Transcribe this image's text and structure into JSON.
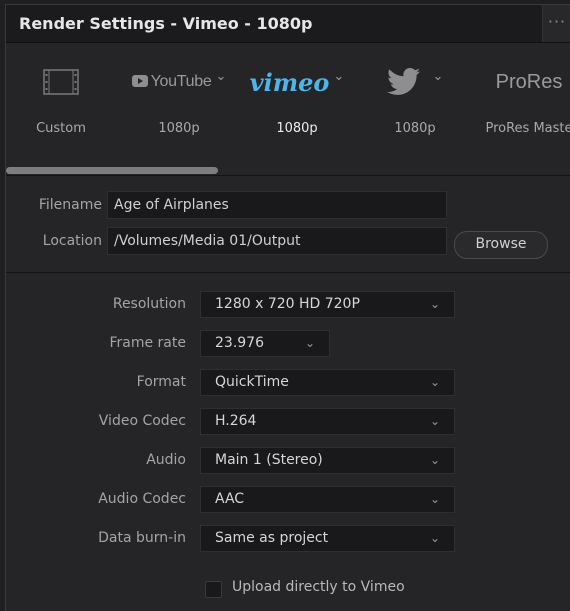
{
  "window": {
    "title": "Render Settings - Vimeo - 1080p",
    "more_icon": "ellipsis-icon",
    "more_glyph": "···"
  },
  "presets": [
    {
      "name": "Custom",
      "label": "Custom",
      "icon": "film-strip-icon"
    },
    {
      "name": "YouTube",
      "logo_text": "YouTube",
      "label": "1080p",
      "icon": "youtube-logo-icon"
    },
    {
      "name": "Vimeo",
      "logo_text": "vimeo",
      "label": "1080p",
      "icon": "vimeo-logo-icon",
      "active": true,
      "accent": "#4db6e8"
    },
    {
      "name": "Twitter",
      "label": "1080p",
      "icon": "twitter-bird-icon"
    },
    {
      "name": "ProRes",
      "logo_text": "ProRes",
      "label": "ProRes Maste"
    }
  ],
  "chevron_glyph": "⌄",
  "file": {
    "filename_label": "Filename",
    "filename_value": "Age of Airplanes",
    "location_label": "Location",
    "location_value": "/Volumes/Media 01/Output",
    "browse_label": "Browse"
  },
  "settings": {
    "resolution": {
      "label": "Resolution",
      "value": "1280 x 720 HD 720P"
    },
    "frame_rate": {
      "label": "Frame rate",
      "value": "23.976"
    },
    "format": {
      "label": "Format",
      "value": "QuickTime"
    },
    "video_codec": {
      "label": "Video Codec",
      "value": "H.264"
    },
    "audio": {
      "label": "Audio",
      "value": "Main 1 (Stereo)"
    },
    "audio_codec": {
      "label": "Audio Codec",
      "value": "AAC"
    },
    "data_burn_in": {
      "label": "Data burn-in",
      "value": "Same as project"
    }
  },
  "upload": {
    "label": "Upload directly to Vimeo",
    "checked": false
  },
  "colors": {
    "background": "#252527",
    "field": "#19191b",
    "accent": "#4db6e8"
  }
}
